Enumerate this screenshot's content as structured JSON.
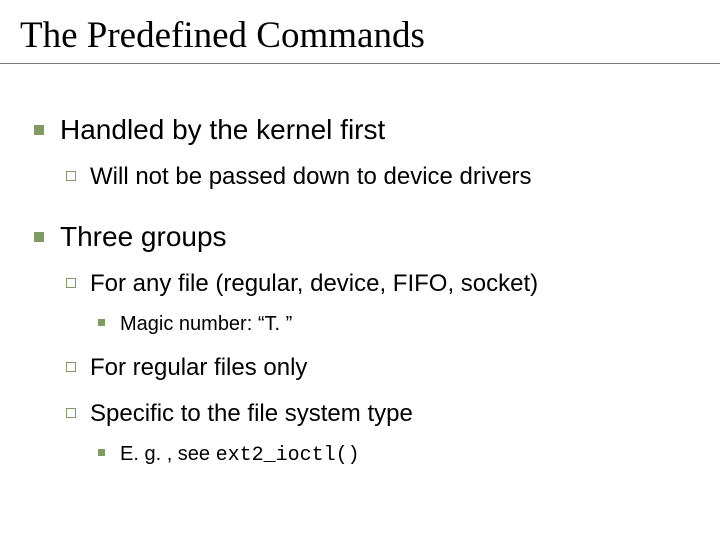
{
  "title": "The Predefined Commands",
  "b1": {
    "text": "Handled by the kernel first",
    "s1": "Will not be passed down to device drivers"
  },
  "b2": {
    "text": "Three groups",
    "g1": {
      "text": "For any file (regular, device, FIFO, socket)",
      "magic": "Magic number: “T. ”"
    },
    "g2": "For regular files only",
    "g3": {
      "text": "Specific to the file system type",
      "eg_pre": "E. g. , see ",
      "eg_code": "ext2_ioctl()"
    }
  }
}
